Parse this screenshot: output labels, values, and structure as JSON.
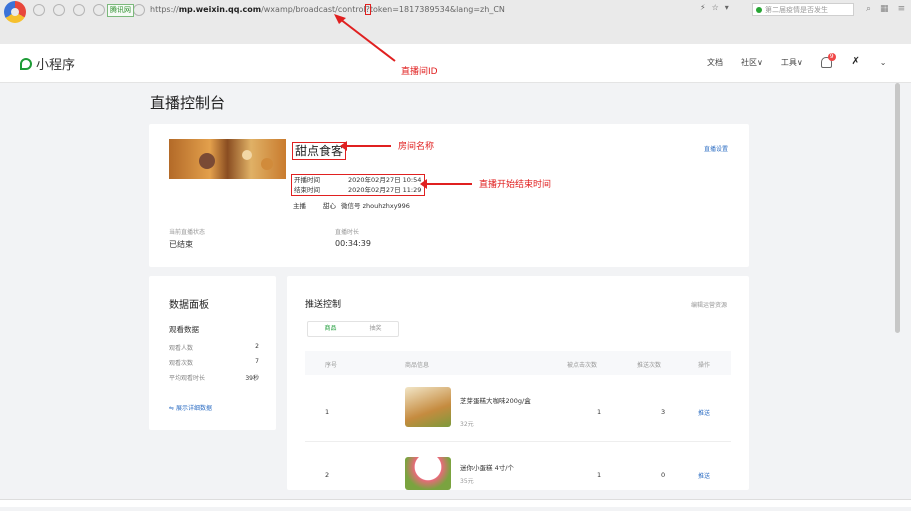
{
  "browser": {
    "badge": "腾讯网",
    "url_prefix": "https://",
    "url_domain": "mp.weixin.qq.com",
    "url_path": "/wxamp/broadcast/control",
    "url_mark": "?",
    "url_query": "token=1817389534&lang=zh_CN",
    "search_placeholder": "第二届疫情是否发生"
  },
  "app": {
    "brand": "小程序",
    "nav": [
      "文档",
      "社区∨",
      "工具∨"
    ],
    "notification_count": "9"
  },
  "page": {
    "title": "直播控制台"
  },
  "room": {
    "name": "甜点食客",
    "settings_link": "直播设置",
    "start_label": "开播时间",
    "start_time": "2020年02月27日 10:54",
    "end_label": "结束时间",
    "end_time": "2020年02月27日 11:29",
    "host_label": "主播",
    "host_name": "甜心",
    "host_wechat": "微信号 zhouhzhxy996",
    "status_label": "当前直播状态",
    "status_value": "已结束",
    "duration_label": "直播时长",
    "duration_value": "00:34:39"
  },
  "data_panel": {
    "title": "数据面板",
    "subtitle": "观看数据",
    "metrics": [
      {
        "label": "观看人数",
        "value": "2"
      },
      {
        "label": "观看次数",
        "value": "7"
      },
      {
        "label": "平均观看时长",
        "value": "39秒"
      }
    ],
    "detail_link": "展示详细数据"
  },
  "push_control": {
    "title": "推送控制",
    "edit_link": "编辑运营资源",
    "tabs": [
      "商品",
      "抽奖"
    ],
    "columns": [
      "序号",
      "商品信息",
      "被点击次数",
      "推送次数",
      "操作"
    ],
    "rows": [
      {
        "index": "1",
        "name": "芝芽蛋糕大咖味200g/盒",
        "price": "32元",
        "clicks": "1",
        "pushes": "3",
        "action": "推送"
      },
      {
        "index": "2",
        "name": "迷你小蛋糕 4寸/个",
        "price": "35元",
        "clicks": "1",
        "pushes": "0",
        "action": "推送"
      }
    ]
  },
  "annotations": {
    "room_id": "直播间ID",
    "room_name": "房间名称",
    "time_range": "直播开始结束时间"
  },
  "colors": {
    "annotation": "#e02020",
    "accent": "#1f9d3a",
    "link": "#2f6fc4"
  }
}
